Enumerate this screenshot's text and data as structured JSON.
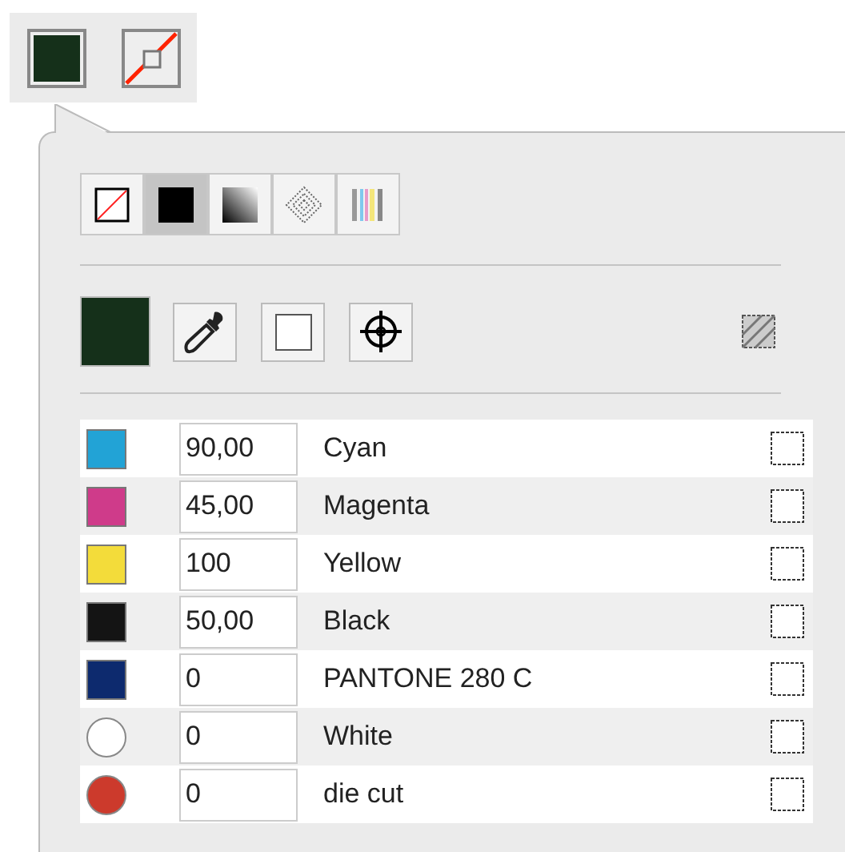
{
  "fill_types": [
    {
      "kind": "none",
      "selected": false
    },
    {
      "kind": "solid",
      "selected": true
    },
    {
      "kind": "gradient",
      "selected": false
    },
    {
      "kind": "pattern",
      "selected": false
    },
    {
      "kind": "separations",
      "selected": false
    }
  ],
  "inks": [
    {
      "kind": "process",
      "color": "#22a3d6",
      "value": "90,00",
      "name": "Cyan",
      "checked": false
    },
    {
      "kind": "process",
      "color": "#cf3b8a",
      "value": "45,00",
      "name": "Magenta",
      "checked": false
    },
    {
      "kind": "process",
      "color": "#f3dc3a",
      "value": "100",
      "name": "Yellow",
      "checked": false
    },
    {
      "kind": "process",
      "color": "#141414",
      "value": "50,00",
      "name": "Black",
      "checked": false
    },
    {
      "kind": "process",
      "color": "#0d2a6e",
      "value": "0",
      "name": "PANTONE 280 C",
      "checked": false
    },
    {
      "kind": "spot",
      "color": "#ffffff",
      "value": "0",
      "name": "White",
      "checked": false
    },
    {
      "kind": "spot",
      "color": "#cc3a2c",
      "value": "0",
      "name": "die cut",
      "checked": false
    }
  ]
}
